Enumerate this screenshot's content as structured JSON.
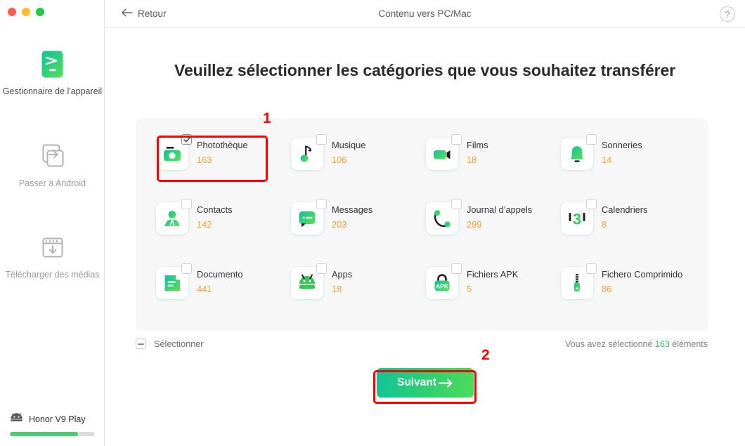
{
  "window": {
    "traffic_lights": [
      "close",
      "minimize",
      "maximize"
    ]
  },
  "sidebar": {
    "items": [
      {
        "label": "Gestionnaire de l'appareil",
        "icon": "device-manager-icon",
        "active": true
      },
      {
        "label": "Passer à Android",
        "icon": "switch-to-android-icon",
        "active": false
      },
      {
        "label": "Télécharger des médias",
        "icon": "download-media-icon",
        "active": false
      }
    ],
    "device": {
      "name": "Honor V9 Play",
      "icon": "android-robot-icon",
      "storage_percent": 80
    }
  },
  "topbar": {
    "back_label": "Retour",
    "back_icon": "arrow-left-icon",
    "title": "Contenu vers PC/Mac",
    "help_label": "?"
  },
  "main": {
    "heading": "Veuillez sélectionner les catégories que vous souhaitez transférer",
    "categories": [
      {
        "name": "Photothèque",
        "count": "163",
        "icon": "camera-icon",
        "checked": true
      },
      {
        "name": "Musique",
        "count": "106",
        "icon": "music-note-icon",
        "checked": false
      },
      {
        "name": "Films",
        "count": "18",
        "icon": "video-camera-icon",
        "checked": false
      },
      {
        "name": "Sonneries",
        "count": "14",
        "icon": "bell-icon",
        "checked": false
      },
      {
        "name": "Contacts",
        "count": "142",
        "icon": "person-icon",
        "checked": false
      },
      {
        "name": "Messages",
        "count": "203",
        "icon": "chat-bubble-icon",
        "checked": false
      },
      {
        "name": "Journal d’appels",
        "count": "299",
        "icon": "phone-handset-icon",
        "checked": false
      },
      {
        "name": "Calendriers",
        "count": "8",
        "icon": "calendar-icon",
        "checked": false
      },
      {
        "name": "Documento",
        "count": "441",
        "icon": "document-icon",
        "checked": false
      },
      {
        "name": "Apps",
        "count": "18",
        "icon": "android-robot-icon",
        "checked": false
      },
      {
        "name": "Fichiers APK",
        "count": "5",
        "icon": "apk-bag-icon",
        "checked": false
      },
      {
        "name": "Fichero Comprimido",
        "count": "86",
        "icon": "zip-file-icon",
        "checked": false
      }
    ],
    "select_all_label": "Sélectionner",
    "select_all_state": "indeterminate",
    "selection_status": {
      "prefix": "Vous avez sélectionné ",
      "count": "163",
      "suffix": " éléments"
    },
    "next_button": {
      "label": "Suivant",
      "icon": "arrow-right-icon"
    }
  },
  "annotations": [
    {
      "number": "1",
      "target": "category-phototheque"
    },
    {
      "number": "2",
      "target": "next-button"
    }
  ],
  "colors": {
    "accent_green": "#3fc16b",
    "count_orange": "#f7a033",
    "annotation_red": "#ff0000",
    "panel_bg": "#f7f7f7"
  }
}
